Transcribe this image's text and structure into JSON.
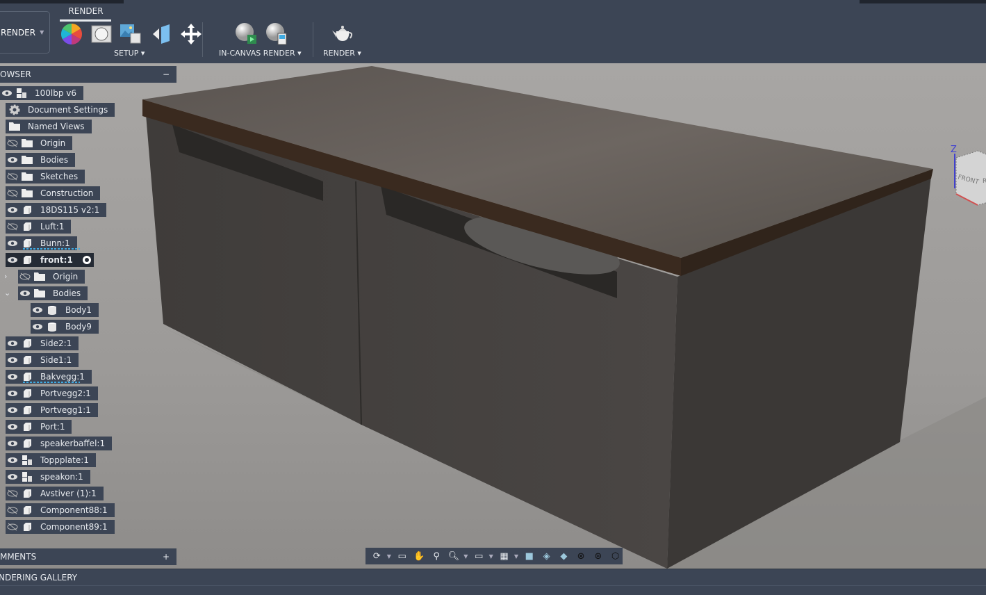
{
  "toolbar": {
    "workspace": "RENDER",
    "active_tab": "RENDER",
    "groups": [
      {
        "label": "SETUP"
      },
      {
        "label": "IN-CANVAS RENDER"
      },
      {
        "label": "RENDER"
      }
    ]
  },
  "browser": {
    "title": "BROWSER",
    "title_visible": "OWSER",
    "collapse": "−",
    "items": [
      {
        "label": "100lbp v6",
        "eye": "visible",
        "icon": "component-multi",
        "level": 0,
        "root": true
      },
      {
        "label": "Document Settings",
        "eye": "none",
        "icon": "gear",
        "level": 1
      },
      {
        "label": "Named Views",
        "eye": "none",
        "icon": "folder",
        "level": 1
      },
      {
        "label": "Origin",
        "eye": "hidden",
        "icon": "folder",
        "level": 1
      },
      {
        "label": "Bodies",
        "eye": "visible",
        "icon": "folder",
        "level": 1
      },
      {
        "label": "Sketches",
        "eye": "hidden",
        "icon": "folder",
        "level": 1
      },
      {
        "label": "Construction",
        "eye": "hidden",
        "icon": "folder",
        "level": 1
      },
      {
        "label": "18DS115 v2:1",
        "eye": "visible",
        "icon": "component",
        "level": 1
      },
      {
        "label": "Luft:1",
        "eye": "hidden",
        "icon": "component",
        "level": 1
      },
      {
        "label": "Bunn:1",
        "eye": "visible",
        "icon": "component",
        "level": 1,
        "underline": true
      },
      {
        "label": "front:1",
        "eye": "visible",
        "icon": "component",
        "level": 1,
        "active": true
      },
      {
        "label": "Origin",
        "eye": "hidden",
        "icon": "folder",
        "level": 2,
        "chevron": "right"
      },
      {
        "label": "Bodies",
        "eye": "visible",
        "icon": "folder",
        "level": 2,
        "chevron": "down"
      },
      {
        "label": "Body1",
        "eye": "visible",
        "icon": "body",
        "level": 3
      },
      {
        "label": "Body9",
        "eye": "visible",
        "icon": "body",
        "level": 3
      },
      {
        "label": "Side2:1",
        "eye": "visible",
        "icon": "component",
        "level": 1
      },
      {
        "label": "Side1:1",
        "eye": "visible",
        "icon": "component",
        "level": 1
      },
      {
        "label": "Bakvegg:1",
        "eye": "visible",
        "icon": "component",
        "level": 1,
        "underline": true
      },
      {
        "label": "Portvegg2:1",
        "eye": "visible",
        "icon": "component",
        "level": 1
      },
      {
        "label": "Portvegg1:1",
        "eye": "visible",
        "icon": "component",
        "level": 1
      },
      {
        "label": "Port:1",
        "eye": "visible",
        "icon": "component",
        "level": 1
      },
      {
        "label": "speakerbaffel:1",
        "eye": "visible",
        "icon": "component",
        "level": 1
      },
      {
        "label": "Toppplate:1",
        "eye": "visible",
        "icon": "component-multi",
        "level": 1
      },
      {
        "label": "speakon:1",
        "eye": "visible",
        "icon": "component-multi",
        "level": 1
      },
      {
        "label": "Avstiver (1):1",
        "eye": "hidden",
        "icon": "component",
        "level": 1
      },
      {
        "label": "Component88:1",
        "eye": "hidden",
        "icon": "component",
        "level": 1
      },
      {
        "label": "Component89:1",
        "eye": "hidden",
        "icon": "component",
        "level": 1
      }
    ]
  },
  "comments": {
    "title": "MMENTS",
    "add": "+"
  },
  "gallery": {
    "title": "NDERING GALLERY"
  },
  "viewcube": {
    "face_front": "FRONT",
    "face_right": "R",
    "axis_z": "Z"
  },
  "colors": {
    "panel": "#3c4555",
    "accent": "#3fa9e0",
    "viewport": "#9c9a98"
  }
}
